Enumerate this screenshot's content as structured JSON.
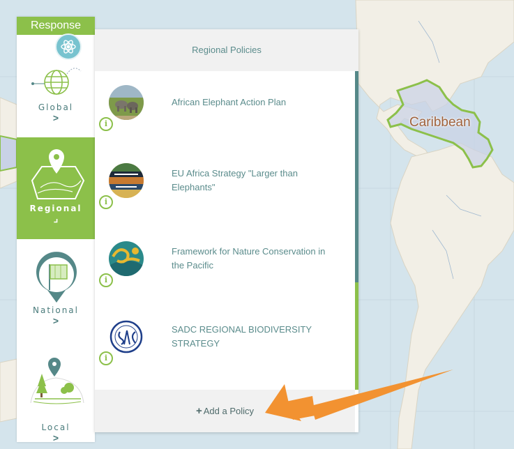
{
  "map": {
    "label": "Caribbean",
    "colors": {
      "ocean": "#d4e4ec",
      "land": "#f2efe6",
      "highlight": "#8cc04a"
    }
  },
  "nav": {
    "header": "Response",
    "items": [
      {
        "label": "Global",
        "chevron": ">",
        "active": false
      },
      {
        "label": "Regional",
        "chevron": "⌟",
        "active": true
      },
      {
        "label": "National",
        "chevron": ">",
        "active": false
      },
      {
        "label": "Local",
        "chevron": ">",
        "active": false
      }
    ]
  },
  "panel": {
    "title": "Regional Policies",
    "policies": [
      {
        "title": "African Elephant Action Plan",
        "info": "i",
        "icon": "elephants-photo"
      },
      {
        "title": "EU Africa Strategy \"Larger than Elephants\"",
        "info": "i",
        "icon": "eu-africa-strategy-cover"
      },
      {
        "title": "Framework for Nature Conservation in the Pacific",
        "info": "i",
        "icon": "pacific-framework-logo"
      },
      {
        "title": "SADC REGIONAL BIODIVERSITY STRATEGY",
        "info": "i",
        "icon": "sadc-logo"
      }
    ],
    "add_policy": "Add a Policy",
    "add_icon": "plus-icon"
  },
  "colors": {
    "accent": "#8cc04a",
    "teal": "#558888",
    "arrow": "#f29231"
  }
}
